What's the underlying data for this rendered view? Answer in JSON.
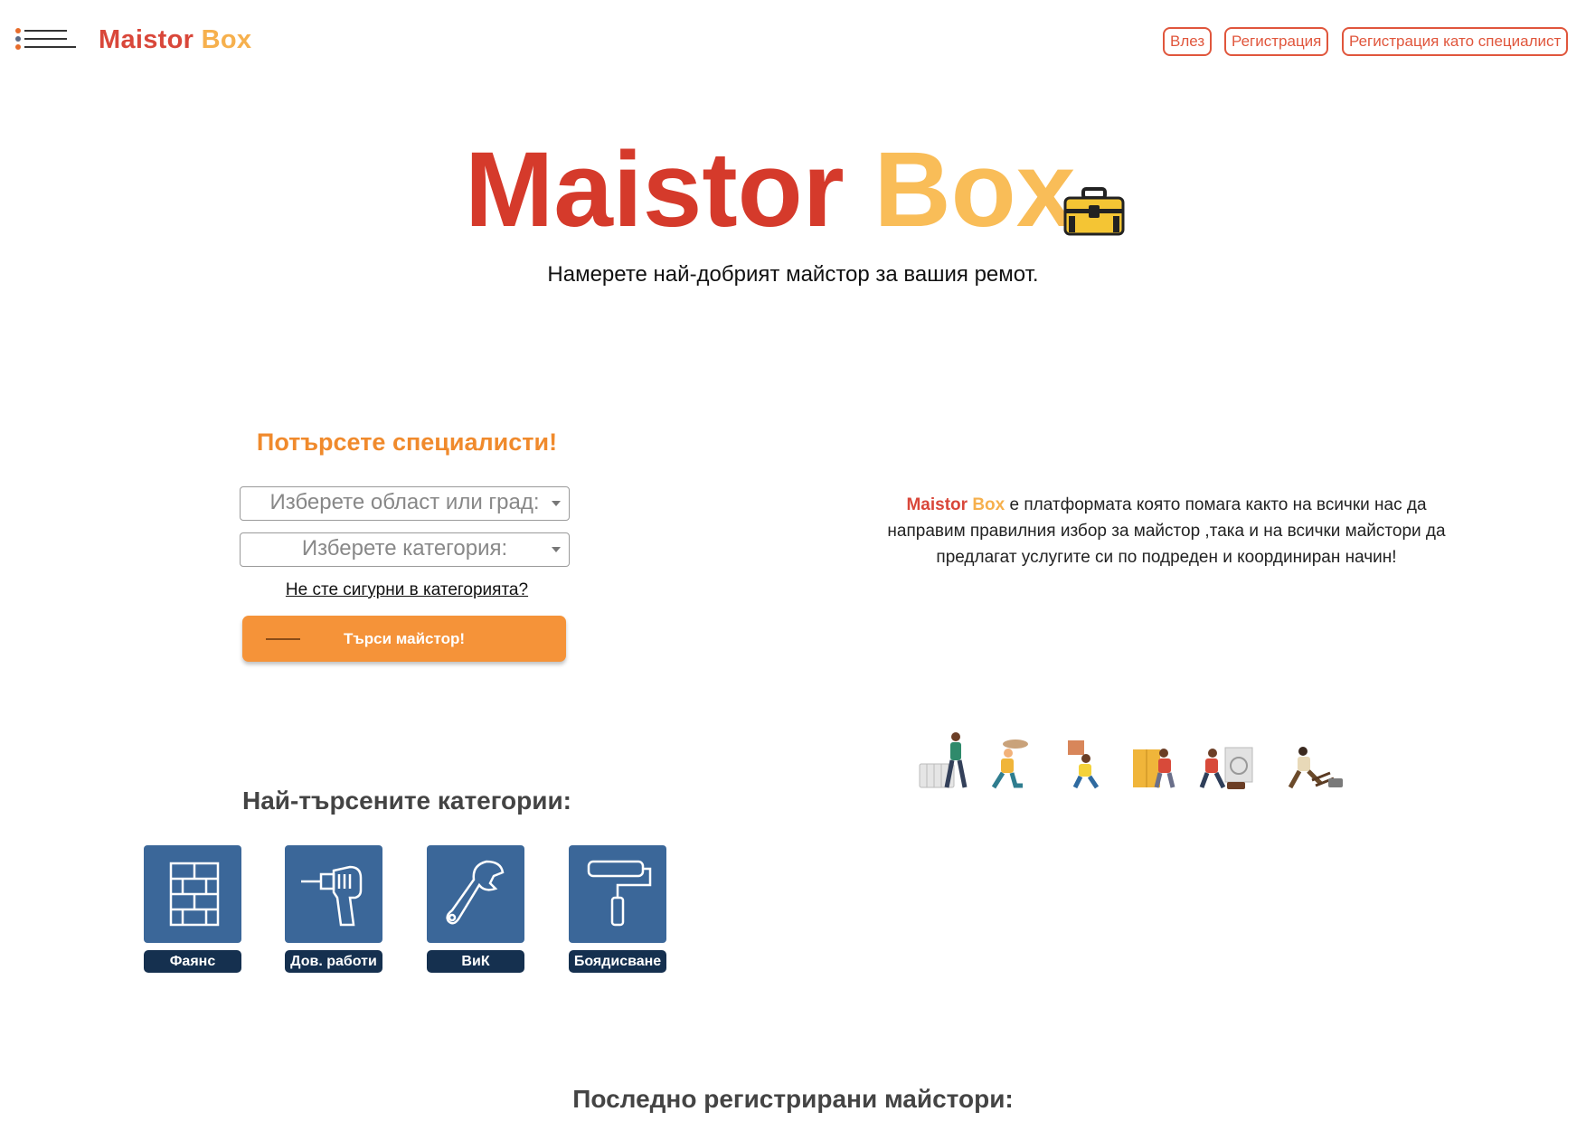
{
  "header": {
    "logo_part1": "Maistor",
    "logo_part2": "Box",
    "login": "Влез",
    "register": "Регистрация",
    "register_specialist": "Регистрация като специалист"
  },
  "hero": {
    "logo_part1": "Maistor",
    "logo_part2": "Box",
    "tagline": "Намерете най-добрият майстор за вашия ремот."
  },
  "search": {
    "title": "Потърсете специалисти!",
    "region_placeholder": "Изберете област или град:",
    "category_placeholder": "Изберете категория:",
    "unsure_link": "Не сте сигурни в категорията?",
    "button_label": "Търси майстор!"
  },
  "about": {
    "brand_part1": "Maistor",
    "brand_part2": "Box",
    "text_line1": " е платформата която помага както на всички нас да",
    "text_line2": "направим правилния избор за майстор ,така и на всички майстори да",
    "text_line3": "предлагат услугите си по подреден и координиран начин!"
  },
  "categories": {
    "title": "Най-търсените категории:",
    "items": [
      {
        "label": "Фаянс",
        "icon": "tiles-icon"
      },
      {
        "label": "Дов. работи",
        "icon": "drill-icon"
      },
      {
        "label": "ВиК",
        "icon": "wrench-icon"
      },
      {
        "label": "Боядисване",
        "icon": "paint-roller-icon"
      }
    ]
  },
  "latest": {
    "title": "Последно регистрирани майстори:"
  },
  "colors": {
    "brand_red": "#d9473a",
    "brand_yellow": "#f6b04d",
    "accent_orange": "#f59339",
    "tile_blue": "#3b6799",
    "label_navy": "#15304f"
  }
}
